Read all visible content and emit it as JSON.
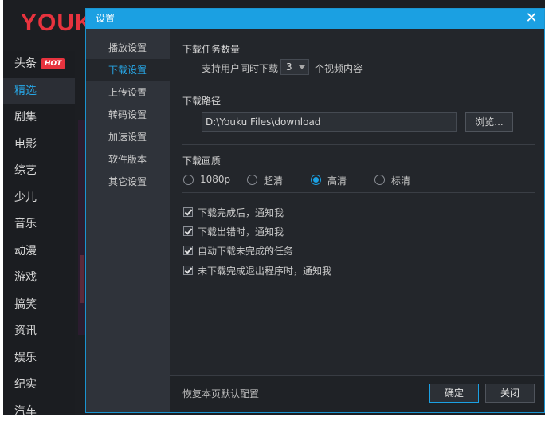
{
  "app": {
    "logo": "YOUK",
    "hot_badge": "HOT",
    "nav": [
      {
        "label": "头条"
      },
      {
        "label": "精选"
      },
      {
        "label": "剧集"
      },
      {
        "label": "电影"
      },
      {
        "label": "综艺"
      },
      {
        "label": "少儿"
      },
      {
        "label": "音乐"
      },
      {
        "label": "动漫"
      },
      {
        "label": "游戏"
      },
      {
        "label": "搞笑"
      },
      {
        "label": "资讯"
      },
      {
        "label": "娱乐"
      },
      {
        "label": "纪实"
      },
      {
        "label": "汽车"
      }
    ]
  },
  "dialog": {
    "title": "设置",
    "close": "✕",
    "side_items": [
      {
        "label": "播放设置"
      },
      {
        "label": "下载设置"
      },
      {
        "label": "上传设置"
      },
      {
        "label": "转码设置"
      },
      {
        "label": "加速设置"
      },
      {
        "label": "软件版本"
      },
      {
        "label": "其它设置"
      }
    ],
    "task_count": {
      "heading": "下载任务数量",
      "prefix": "支持用户同时下载",
      "value": "3",
      "suffix": "个视频内容"
    },
    "path": {
      "heading": "下载路径",
      "value": "D:\\Youku Files\\download",
      "browse": "浏览..."
    },
    "quality": {
      "heading": "下载画质",
      "options": [
        {
          "label": "1080p",
          "checked": false
        },
        {
          "label": "超清",
          "checked": false
        },
        {
          "label": "高清",
          "checked": true
        },
        {
          "label": "标清",
          "checked": false
        }
      ]
    },
    "notifications": [
      {
        "label": "下载完成后，通知我",
        "checked": true
      },
      {
        "label": "下载出错时，通知我",
        "checked": true
      },
      {
        "label": "自动下载未完成的任务",
        "checked": true
      },
      {
        "label": "未下载完成退出程序时，通知我",
        "checked": true
      }
    ],
    "footer": {
      "reset": "恢复本页默认配置",
      "ok": "确定",
      "cancel": "关闭"
    }
  },
  "colors": {
    "accent": "#1ba0e2",
    "brand_red": "#e7333e",
    "dialog_bg": "#23262b",
    "sidebar_bg": "#2f333a"
  }
}
